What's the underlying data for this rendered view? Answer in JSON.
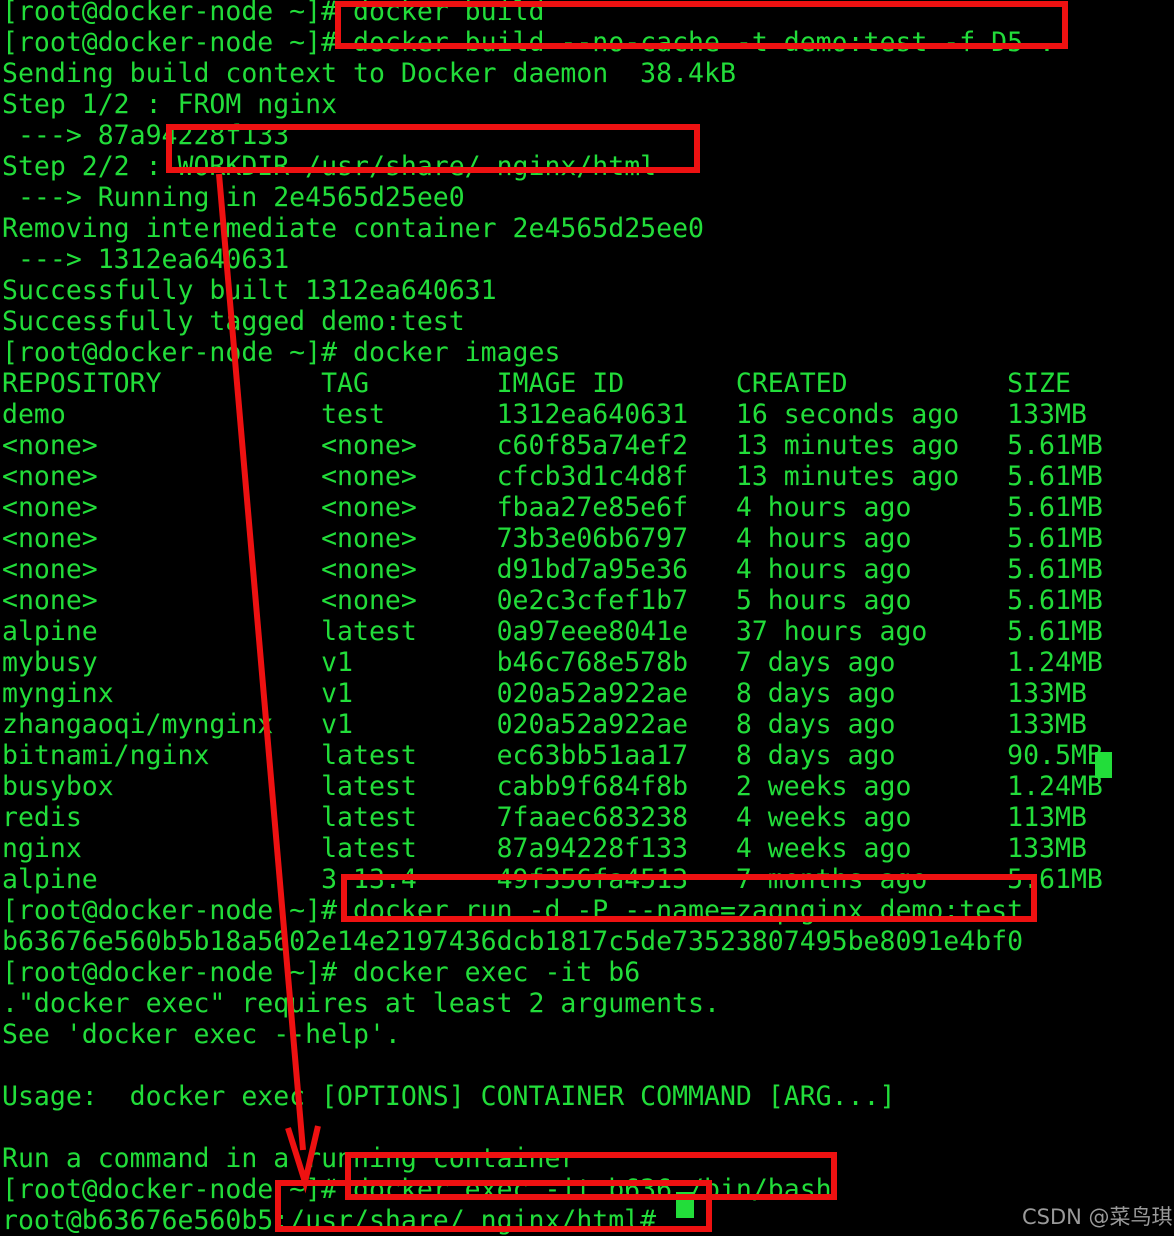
{
  "terminal": {
    "background_color": "#000000",
    "text_color": "#22dd3a",
    "annotation_color": "#ee1111",
    "lines": [
      {
        "id": "l0",
        "text": "[root@docker-node ~]# docker build"
      },
      {
        "id": "l1",
        "text": "[root@docker-node ~]# docker build --no-cache -t demo:test -f D5 ."
      },
      {
        "id": "l2",
        "text": "Sending build context to Docker daemon  38.4kB"
      },
      {
        "id": "l3",
        "text": "Step 1/2 : FROM nginx"
      },
      {
        "id": "l4",
        "text": " ---> 87a94228f133"
      },
      {
        "id": "l5",
        "text": "Step 2/2 : WORKDIR /usr/share/ nginx/html"
      },
      {
        "id": "l6",
        "text": " ---> Running in 2e4565d25ee0"
      },
      {
        "id": "l7",
        "text": "Removing intermediate container 2e4565d25ee0"
      },
      {
        "id": "l8",
        "text": " ---> 1312ea640631"
      },
      {
        "id": "l9",
        "text": "Successfully built 1312ea640631"
      },
      {
        "id": "l10",
        "text": "Successfully tagged demo:test"
      },
      {
        "id": "l11",
        "text": "[root@docker-node ~]# docker images"
      },
      {
        "id": "l12",
        "text": "REPOSITORY          TAG        IMAGE ID       CREATED          SIZE"
      },
      {
        "id": "l13",
        "text": "demo                test       1312ea640631   16 seconds ago   133MB"
      },
      {
        "id": "l14",
        "text": "<none>              <none>     c60f85a74ef2   13 minutes ago   5.61MB"
      },
      {
        "id": "l15",
        "text": "<none>              <none>     cfcb3d1c4d8f   13 minutes ago   5.61MB"
      },
      {
        "id": "l16",
        "text": "<none>              <none>     fbaa27e85e6f   4 hours ago      5.61MB"
      },
      {
        "id": "l17",
        "text": "<none>              <none>     73b3e06b6797   4 hours ago      5.61MB"
      },
      {
        "id": "l18",
        "text": "<none>              <none>     d91bd7a95e36   4 hours ago      5.61MB"
      },
      {
        "id": "l19",
        "text": "<none>              <none>     0e2c3cfef1b7   5 hours ago      5.61MB"
      },
      {
        "id": "l20",
        "text": "alpine              latest     0a97eee8041e   37 hours ago     5.61MB"
      },
      {
        "id": "l21",
        "text": "mybusy              v1         b46c768e578b   7 days ago       1.24MB"
      },
      {
        "id": "l22",
        "text": "mynginx             v1         020a52a922ae   8 days ago       133MB"
      },
      {
        "id": "l23",
        "text": "zhangaoqi/mynginx   v1         020a52a922ae   8 days ago       133MB"
      },
      {
        "id": "l24",
        "text": "bitnami/nginx       latest     ec63bb51aa17   8 days ago       90.5MB"
      },
      {
        "id": "l25",
        "text": "busybox             latest     cabb9f684f8b   2 weeks ago      1.24MB"
      },
      {
        "id": "l26",
        "text": "redis               latest     7faaec683238   4 weeks ago      113MB"
      },
      {
        "id": "l27",
        "text": "nginx               latest     87a94228f133   4 weeks ago      133MB"
      },
      {
        "id": "l28",
        "text": "alpine              3.13.4     49f356fa4513   7 months ago     5.61MB"
      },
      {
        "id": "l29",
        "text": "[root@docker-node ~]# docker run -d -P --name=zaqnginx demo:test"
      },
      {
        "id": "l30",
        "text": "b63676e560b5b18a5602e14e2197436dcb1817c5de73523807495be8091e4bf0"
      },
      {
        "id": "l31",
        "text": "[root@docker-node ~]# docker exec -it b6"
      },
      {
        "id": "l32",
        "text": ".\"docker exec\" requires at least 2 arguments."
      },
      {
        "id": "l33",
        "text": "See 'docker exec --help'."
      },
      {
        "id": "l34",
        "text": ""
      },
      {
        "id": "l35",
        "text": "Usage:  docker exec [OPTIONS] CONTAINER COMMAND [ARG...]"
      },
      {
        "id": "l36",
        "text": ""
      },
      {
        "id": "l37",
        "text": "Run a command in a running container"
      },
      {
        "id": "l38",
        "text": "[root@docker-node ~]# docker exec -it b636 /bin/bash"
      },
      {
        "id": "l39",
        "text": "root@b63676e560b5:/usr/share/ nginx/html# "
      }
    ]
  },
  "images_table": {
    "headers": [
      "REPOSITORY",
      "TAG",
      "IMAGE ID",
      "CREATED",
      "SIZE"
    ],
    "rows": [
      [
        "demo",
        "test",
        "1312ea640631",
        "16 seconds ago",
        "133MB"
      ],
      [
        "<none>",
        "<none>",
        "c60f85a74ef2",
        "13 minutes ago",
        "5.61MB"
      ],
      [
        "<none>",
        "<none>",
        "cfcb3d1c4d8f",
        "13 minutes ago",
        "5.61MB"
      ],
      [
        "<none>",
        "<none>",
        "fbaa27e85e6f",
        "4 hours ago",
        "5.61MB"
      ],
      [
        "<none>",
        "<none>",
        "73b3e06b6797",
        "4 hours ago",
        "5.61MB"
      ],
      [
        "<none>",
        "<none>",
        "d91bd7a95e36",
        "4 hours ago",
        "5.61MB"
      ],
      [
        "<none>",
        "<none>",
        "0e2c3cfef1b7",
        "5 hours ago",
        "5.61MB"
      ],
      [
        "alpine",
        "latest",
        "0a97eee8041e",
        "37 hours ago",
        "5.61MB"
      ],
      [
        "mybusy",
        "v1",
        "b46c768e578b",
        "7 days ago",
        "1.24MB"
      ],
      [
        "mynginx",
        "v1",
        "020a52a922ae",
        "8 days ago",
        "133MB"
      ],
      [
        "zhangaoqi/mynginx",
        "v1",
        "020a52a922ae",
        "8 days ago",
        "133MB"
      ],
      [
        "bitnami/nginx",
        "latest",
        "ec63bb51aa17",
        "8 days ago",
        "90.5MB"
      ],
      [
        "busybox",
        "latest",
        "cabb9f684f8b",
        "2 weeks ago",
        "1.24MB"
      ],
      [
        "redis",
        "latest",
        "7faaec683238",
        "4 weeks ago",
        "113MB"
      ],
      [
        "nginx",
        "latest",
        "87a94228f133",
        "4 weeks ago",
        "133MB"
      ],
      [
        "alpine",
        "3.13.4",
        "49f356fa4513",
        "7 months ago",
        "5.61MB"
      ]
    ]
  },
  "annotations": {
    "highlight_boxes": [
      {
        "id": "box-build-cmd",
        "label": "docker build --no-cache -t demo:test -f D5 ."
      },
      {
        "id": "box-workdir",
        "label": "WORKDIR /usr/share/ nginx/html"
      },
      {
        "id": "box-run-cmd",
        "label": "docker run -d -P --name=zaqnginx demo:test"
      },
      {
        "id": "box-exec-cmd",
        "label": "docker exec -it b636 /bin/bash"
      },
      {
        "id": "box-container-prompt",
        "label": "/usr/share/ nginx/html#"
      }
    ],
    "arrow": {
      "label": "workdir-to-container-path-arrow",
      "from": "WORKDIR /usr/share/ nginx/html",
      "to": "root@b63676e560b5:/usr/share/ nginx/html#"
    }
  },
  "watermark": {
    "text": "CSDN @菜鸟琪"
  }
}
